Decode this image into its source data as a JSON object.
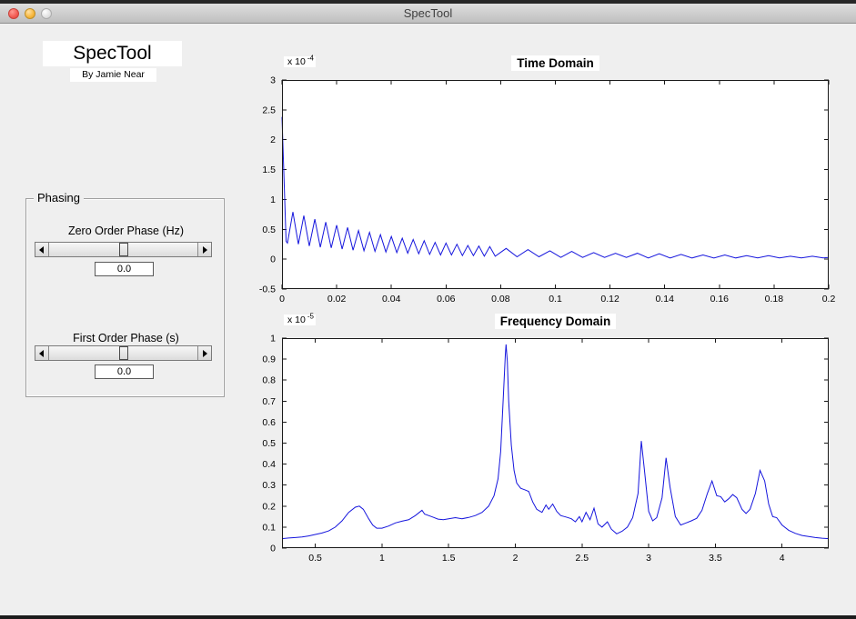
{
  "window": {
    "title": "SpecTool",
    "buttons": {
      "close": "close",
      "minimize": "minimize",
      "zoom": "zoom"
    }
  },
  "branding": {
    "app_title": "SpecTool",
    "byline": "By Jamie Near"
  },
  "phasing_panel": {
    "title": "Phasing",
    "sliders": [
      {
        "label": "Zero Order Phase (Hz)",
        "value": "0.0",
        "thumb_percent": 50
      },
      {
        "label": "First Order Phase (s)",
        "value": "0.0",
        "thumb_percent": 50
      }
    ]
  },
  "colors": {
    "trace": "#1515dd",
    "axis": "#1a1a1a",
    "figure_bg": "#efefef",
    "axes_bg": "#ffffff"
  },
  "chart_data": [
    {
      "type": "line",
      "title": "Time Domain",
      "exponent_prefix": "x 10",
      "exponent": "-4",
      "xlim": [
        0,
        0.2
      ],
      "ylim": [
        -0.5,
        3
      ],
      "xtick_values": [
        0,
        0.02,
        0.04,
        0.06,
        0.08,
        0.1,
        0.12,
        0.14,
        0.16,
        0.18,
        0.2
      ],
      "xtick_labels": [
        "0",
        "0.02",
        "0.04",
        "0.06",
        "0.08",
        "0.1",
        "0.12",
        "0.14",
        "0.16",
        "0.18",
        "0.2"
      ],
      "ytick_values": [
        -0.5,
        0,
        0.5,
        1,
        1.5,
        2,
        2.5,
        3
      ],
      "ytick_labels": [
        "-0.5",
        "0",
        "0.5",
        "1",
        "1.5",
        "2",
        "2.5",
        "3"
      ],
      "grid": false,
      "legend": null,
      "line_color": "#1515dd",
      "points": [
        [
          0,
          2.38
        ],
        [
          0.0015,
          0.3
        ],
        [
          0.002,
          0.27
        ],
        [
          0.004,
          0.79
        ],
        [
          0.006,
          0.25
        ],
        [
          0.008,
          0.73
        ],
        [
          0.01,
          0.22
        ],
        [
          0.012,
          0.67
        ],
        [
          0.014,
          0.2
        ],
        [
          0.016,
          0.62
        ],
        [
          0.018,
          0.19
        ],
        [
          0.02,
          0.57
        ],
        [
          0.022,
          0.17
        ],
        [
          0.024,
          0.53
        ],
        [
          0.026,
          0.15
        ],
        [
          0.028,
          0.48
        ],
        [
          0.03,
          0.14
        ],
        [
          0.032,
          0.45
        ],
        [
          0.034,
          0.13
        ],
        [
          0.036,
          0.41
        ],
        [
          0.038,
          0.12
        ],
        [
          0.04,
          0.38
        ],
        [
          0.042,
          0.11
        ],
        [
          0.044,
          0.35
        ],
        [
          0.046,
          0.1
        ],
        [
          0.048,
          0.33
        ],
        [
          0.05,
          0.09
        ],
        [
          0.052,
          0.31
        ],
        [
          0.054,
          0.08
        ],
        [
          0.056,
          0.28
        ],
        [
          0.058,
          0.07
        ],
        [
          0.06,
          0.27
        ],
        [
          0.062,
          0.07
        ],
        [
          0.064,
          0.25
        ],
        [
          0.066,
          0.06
        ],
        [
          0.068,
          0.23
        ],
        [
          0.07,
          0.06
        ],
        [
          0.072,
          0.22
        ],
        [
          0.074,
          0.05
        ],
        [
          0.076,
          0.21
        ],
        [
          0.078,
          0.05
        ],
        [
          0.082,
          0.18
        ],
        [
          0.086,
          0.04
        ],
        [
          0.09,
          0.16
        ],
        [
          0.094,
          0.04
        ],
        [
          0.098,
          0.14
        ],
        [
          0.102,
          0.03
        ],
        [
          0.106,
          0.13
        ],
        [
          0.11,
          0.03
        ],
        [
          0.114,
          0.11
        ],
        [
          0.118,
          0.03
        ],
        [
          0.122,
          0.1
        ],
        [
          0.126,
          0.03
        ],
        [
          0.13,
          0.1
        ],
        [
          0.134,
          0.02
        ],
        [
          0.138,
          0.09
        ],
        [
          0.142,
          0.02
        ],
        [
          0.146,
          0.08
        ],
        [
          0.15,
          0.02
        ],
        [
          0.154,
          0.07
        ],
        [
          0.158,
          0.02
        ],
        [
          0.162,
          0.07
        ],
        [
          0.166,
          0.02
        ],
        [
          0.17,
          0.06
        ],
        [
          0.174,
          0.02
        ],
        [
          0.178,
          0.06
        ],
        [
          0.182,
          0.02
        ],
        [
          0.186,
          0.05
        ],
        [
          0.19,
          0.02
        ],
        [
          0.194,
          0.05
        ],
        [
          0.198,
          0.02
        ],
        [
          0.2,
          0.03
        ]
      ]
    },
    {
      "type": "line",
      "title": "Frequency Domain",
      "exponent_prefix": "x 10",
      "exponent": "-5",
      "xlim": [
        0.25,
        4.35
      ],
      "ylim": [
        0,
        1
      ],
      "xtick_values": [
        0.5,
        1,
        1.5,
        2,
        2.5,
        3,
        3.5,
        4
      ],
      "xtick_labels": [
        "0.5",
        "1",
        "1.5",
        "2",
        "2.5",
        "3",
        "3.5",
        "4"
      ],
      "ytick_values": [
        0,
        0.1,
        0.2,
        0.3,
        0.4,
        0.5,
        0.6,
        0.7,
        0.8,
        0.9,
        1
      ],
      "ytick_labels": [
        "0",
        "0.1",
        "0.2",
        "0.3",
        "0.4",
        "0.5",
        "0.6",
        "0.7",
        "0.8",
        "0.9",
        "1"
      ],
      "grid": false,
      "legend": null,
      "line_color": "#1515dd",
      "points": [
        [
          0.25,
          0.045
        ],
        [
          0.3,
          0.048
        ],
        [
          0.35,
          0.05
        ],
        [
          0.4,
          0.053
        ],
        [
          0.45,
          0.058
        ],
        [
          0.5,
          0.065
        ],
        [
          0.55,
          0.072
        ],
        [
          0.6,
          0.082
        ],
        [
          0.65,
          0.1
        ],
        [
          0.7,
          0.13
        ],
        [
          0.75,
          0.17
        ],
        [
          0.8,
          0.195
        ],
        [
          0.83,
          0.2
        ],
        [
          0.86,
          0.185
        ],
        [
          0.9,
          0.14
        ],
        [
          0.93,
          0.11
        ],
        [
          0.96,
          0.095
        ],
        [
          1.0,
          0.095
        ],
        [
          1.05,
          0.105
        ],
        [
          1.1,
          0.12
        ],
        [
          1.15,
          0.128
        ],
        [
          1.2,
          0.135
        ],
        [
          1.25,
          0.155
        ],
        [
          1.28,
          0.17
        ],
        [
          1.3,
          0.18
        ],
        [
          1.32,
          0.162
        ],
        [
          1.35,
          0.155
        ],
        [
          1.38,
          0.148
        ],
        [
          1.42,
          0.138
        ],
        [
          1.46,
          0.135
        ],
        [
          1.5,
          0.14
        ],
        [
          1.55,
          0.145
        ],
        [
          1.6,
          0.14
        ],
        [
          1.65,
          0.146
        ],
        [
          1.7,
          0.155
        ],
        [
          1.75,
          0.17
        ],
        [
          1.8,
          0.2
        ],
        [
          1.84,
          0.25
        ],
        [
          1.87,
          0.33
        ],
        [
          1.89,
          0.46
        ],
        [
          1.91,
          0.72
        ],
        [
          1.925,
          0.92
        ],
        [
          1.93,
          0.97
        ],
        [
          1.94,
          0.89
        ],
        [
          1.95,
          0.7
        ],
        [
          1.97,
          0.49
        ],
        [
          1.99,
          0.37
        ],
        [
          2.01,
          0.31
        ],
        [
          2.04,
          0.285
        ],
        [
          2.07,
          0.278
        ],
        [
          2.1,
          0.27
        ],
        [
          2.13,
          0.22
        ],
        [
          2.16,
          0.185
        ],
        [
          2.2,
          0.17
        ],
        [
          2.23,
          0.205
        ],
        [
          2.25,
          0.185
        ],
        [
          2.28,
          0.21
        ],
        [
          2.31,
          0.175
        ],
        [
          2.34,
          0.155
        ],
        [
          2.38,
          0.148
        ],
        [
          2.42,
          0.14
        ],
        [
          2.45,
          0.125
        ],
        [
          2.48,
          0.15
        ],
        [
          2.5,
          0.125
        ],
        [
          2.53,
          0.17
        ],
        [
          2.56,
          0.135
        ],
        [
          2.59,
          0.19
        ],
        [
          2.62,
          0.115
        ],
        [
          2.65,
          0.1
        ],
        [
          2.69,
          0.125
        ],
        [
          2.72,
          0.09
        ],
        [
          2.76,
          0.068
        ],
        [
          2.8,
          0.08
        ],
        [
          2.84,
          0.1
        ],
        [
          2.88,
          0.145
        ],
        [
          2.92,
          0.26
        ],
        [
          2.945,
          0.51
        ],
        [
          2.97,
          0.36
        ],
        [
          3.0,
          0.175
        ],
        [
          3.03,
          0.13
        ],
        [
          3.06,
          0.145
        ],
        [
          3.1,
          0.24
        ],
        [
          3.13,
          0.43
        ],
        [
          3.16,
          0.29
        ],
        [
          3.2,
          0.15
        ],
        [
          3.24,
          0.11
        ],
        [
          3.28,
          0.12
        ],
        [
          3.32,
          0.13
        ],
        [
          3.36,
          0.142
        ],
        [
          3.4,
          0.18
        ],
        [
          3.44,
          0.26
        ],
        [
          3.475,
          0.32
        ],
        [
          3.51,
          0.25
        ],
        [
          3.54,
          0.245
        ],
        [
          3.57,
          0.22
        ],
        [
          3.6,
          0.235
        ],
        [
          3.63,
          0.255
        ],
        [
          3.66,
          0.24
        ],
        [
          3.7,
          0.185
        ],
        [
          3.73,
          0.165
        ],
        [
          3.76,
          0.185
        ],
        [
          3.8,
          0.26
        ],
        [
          3.835,
          0.37
        ],
        [
          3.87,
          0.32
        ],
        [
          3.9,
          0.21
        ],
        [
          3.93,
          0.15
        ],
        [
          3.96,
          0.145
        ],
        [
          4.0,
          0.11
        ],
        [
          4.05,
          0.085
        ],
        [
          4.1,
          0.07
        ],
        [
          4.15,
          0.06
        ],
        [
          4.2,
          0.055
        ],
        [
          4.25,
          0.05
        ],
        [
          4.3,
          0.047
        ],
        [
          4.35,
          0.045
        ]
      ]
    }
  ]
}
